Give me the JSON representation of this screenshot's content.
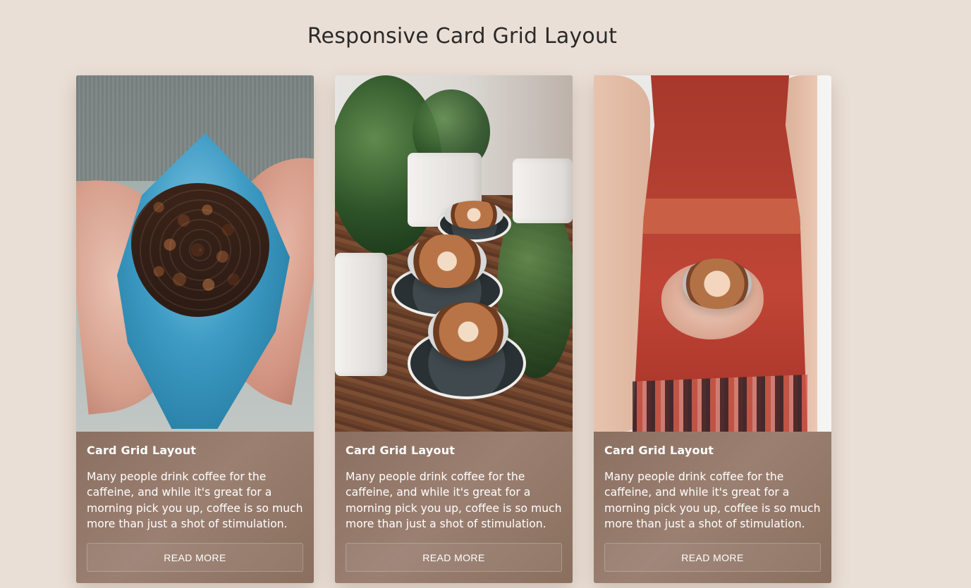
{
  "page": {
    "title": "Responsive Card Grid Layout"
  },
  "cards": [
    {
      "title": "Card Grid Layout",
      "text": "Many people drink coffee for the caffeine, and while it's great for a morning pick you up, coffee is so much more than just a shot of stimulation.",
      "button": "READ MORE"
    },
    {
      "title": "Card Grid Layout",
      "text": "Many people drink coffee for the caffeine, and while it's great for a morning pick you up, coffee is so much more than just a shot of stimulation.",
      "button": "READ MORE"
    },
    {
      "title": "Card Grid Layout",
      "text": "Many people drink coffee for the caffeine, and while it's great for a morning pick you up, coffee is so much more than just a shot of stimulation.",
      "button": "READ MORE"
    }
  ],
  "colors": {
    "background": "#eadfd6",
    "card_content": "#8f7565",
    "title_text": "#2b2a2a",
    "card_text": "#ffffff"
  }
}
